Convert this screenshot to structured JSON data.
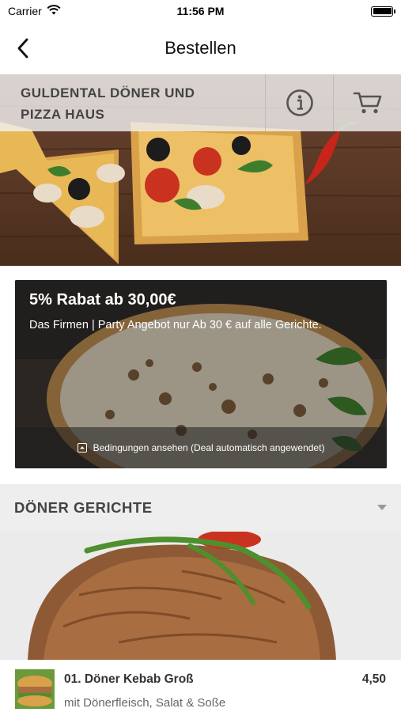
{
  "status_bar": {
    "carrier": "Carrier",
    "time": "11:56 PM"
  },
  "nav": {
    "title": "Bestellen"
  },
  "restaurant": {
    "name_line1": "GULDENTAL DÖNER UND",
    "name_line2": "PIZZA HAUS"
  },
  "deal": {
    "title": "5% Rabat ab 30,00€",
    "description": "Das Firmen | Party Angebot nur Ab 30 € auf alle Gerichte.",
    "footer": "Bedingungen ansehen (Deal automatisch angewendet)"
  },
  "category": {
    "title": "DÖNER GERICHTE"
  },
  "items": [
    {
      "name": "01. Döner Kebab Groß",
      "description": "mit Dönerfleisch, Salat & Soße",
      "price": "4,50"
    }
  ]
}
